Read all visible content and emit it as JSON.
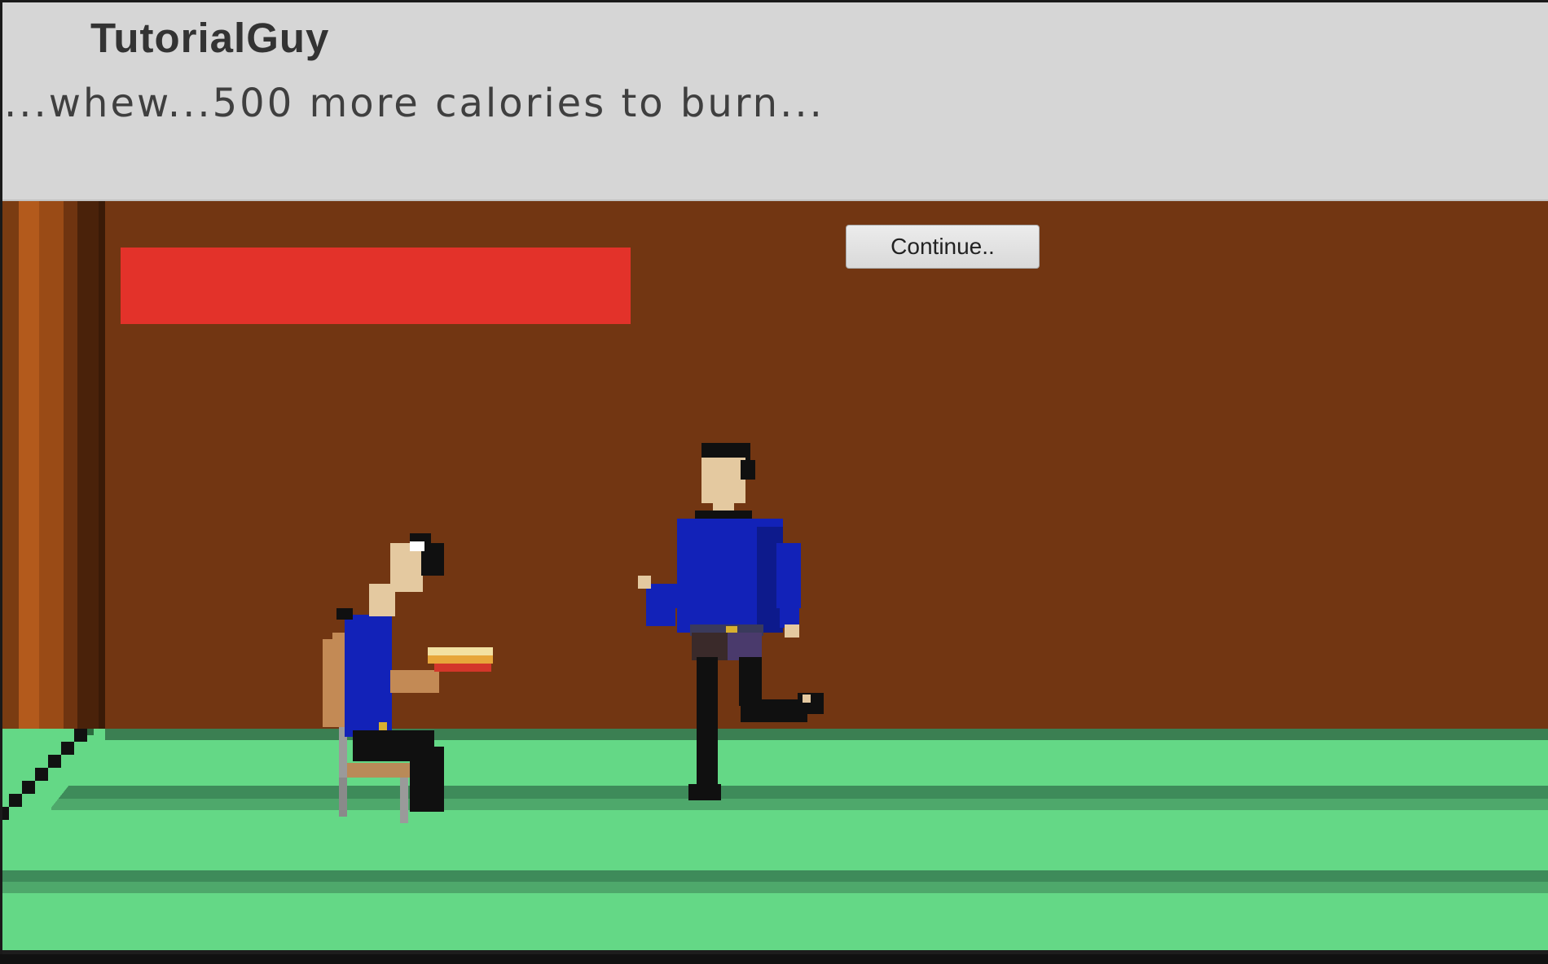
{
  "dialog": {
    "speaker": "TutorialGuy",
    "text": "...whew...500 more calories to burn..."
  },
  "controls": {
    "continue_label": "Continue.."
  },
  "hud": {
    "health_bar_color": "#e3322a"
  },
  "scene": {
    "wall_color": "#723612",
    "floor_color": "#64d886",
    "floor_stripe_color": "#4aa66a",
    "seated_character": "seated-person-with-pizza",
    "running_character": "running-man"
  }
}
